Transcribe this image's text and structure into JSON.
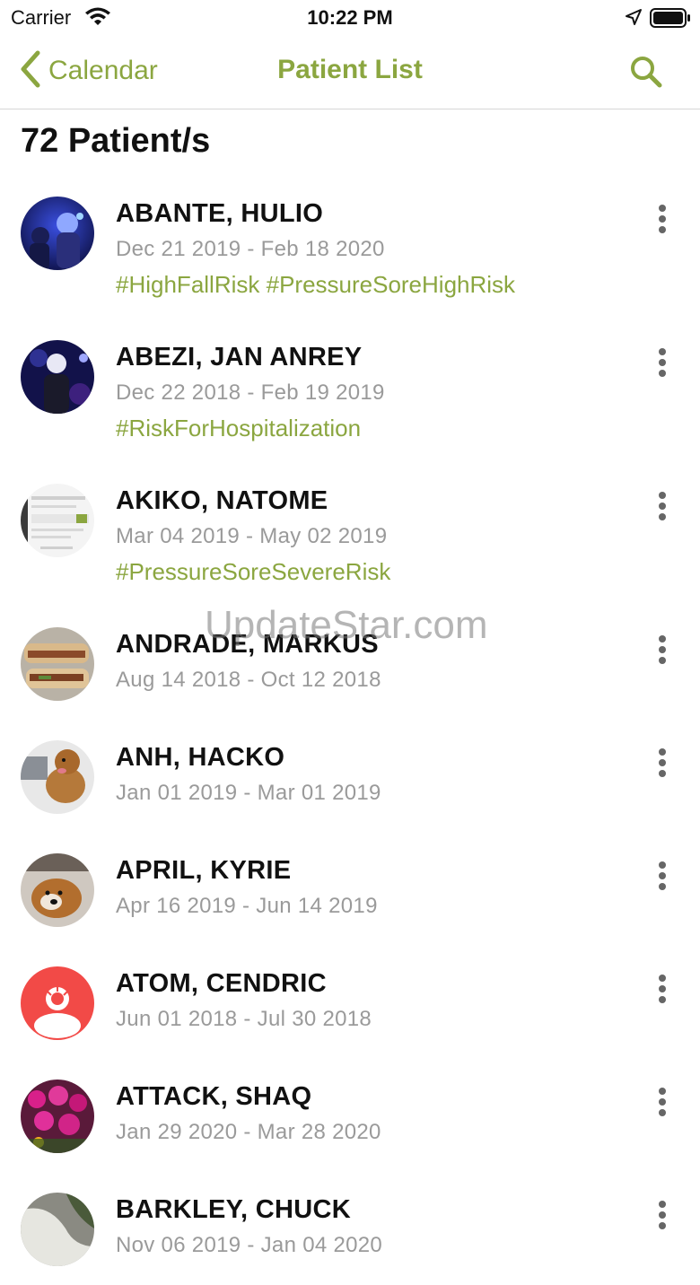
{
  "status_bar": {
    "carrier": "Carrier",
    "time": "10:22 PM"
  },
  "nav": {
    "back_label": "Calendar",
    "title": "Patient List"
  },
  "patient_count": "72 Patient/s",
  "patients": [
    {
      "name": "ABANTE, HULIO",
      "dates": "Dec 21 2019 - Feb 18 2020",
      "tags": "#HighFallRisk #PressureSoreHighRisk"
    },
    {
      "name": "ABEZI, JAN ANREY",
      "dates": "Dec 22 2018 - Feb 19 2019",
      "tags": "#RiskForHospitalization"
    },
    {
      "name": "AKIKO, NATOME",
      "dates": "Mar 04 2019 - May 02 2019",
      "tags": "#PressureSoreSevereRisk"
    },
    {
      "name": "ANDRADE, MARKUS",
      "dates": "Aug 14 2018 - Oct 12 2018"
    },
    {
      "name": "ANH, HACKO",
      "dates": "Jan 01 2019 - Mar 01 2019"
    },
    {
      "name": "APRIL, KYRIE",
      "dates": "Apr 16 2019 - Jun 14 2019"
    },
    {
      "name": "ATOM, CENDRIC",
      "dates": "Jun 01 2018 - Jul 30 2018"
    },
    {
      "name": "ATTACK, SHAQ",
      "dates": "Jan 29 2020 - Mar 28 2020"
    },
    {
      "name": "BARKLEY, CHUCK",
      "dates": "Nov 06 2019 - Jan 04 2020"
    }
  ],
  "watermark": "UpdateStar.com",
  "colors": {
    "accent": "#8ba640",
    "secondary_text": "#9a9a9a",
    "divider": "#d6d6d6"
  }
}
